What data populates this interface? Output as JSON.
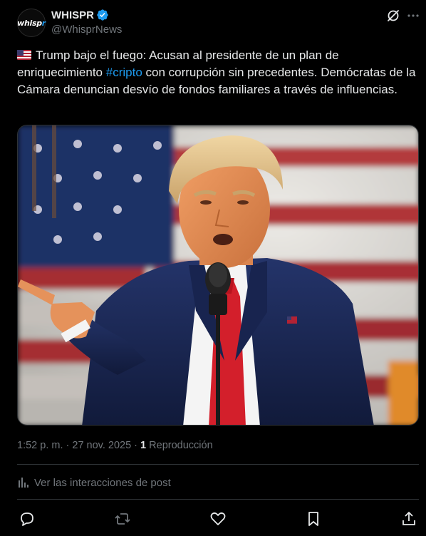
{
  "author": {
    "display_name": "WHISPR",
    "handle": "@WhisprNews",
    "avatar_text_main": "whisp",
    "avatar_text_accent": "r",
    "verified": true
  },
  "post": {
    "flag_icon": "us-flag-icon",
    "text_before_hashtag": "Trump bajo el fuego: Acusan al presidente de un plan de enriquecimiento ",
    "hashtag": "#cripto",
    "text_after_hashtag": " con corrupción sin precedentes. Demócratas de la Cámara denuncian desvío de fondos familiares a través de influencias."
  },
  "meta": {
    "time": "1:52 p. m.",
    "separator": " · ",
    "date": "27 nov. 2025",
    "views_count": "1",
    "views_label": "Reproducción"
  },
  "analytics_label": "Ver las interacciones de post",
  "actions": {
    "reply_icon": "reply-icon",
    "repost_icon": "repost-icon",
    "like_icon": "like-icon",
    "bookmark_icon": "bookmark-icon",
    "share_icon": "share-icon"
  },
  "colors": {
    "background": "#000000",
    "text_primary": "#e7e9ea",
    "text_secondary": "#71767b",
    "accent": "#1d9bf0",
    "divider": "#2f3336"
  }
}
